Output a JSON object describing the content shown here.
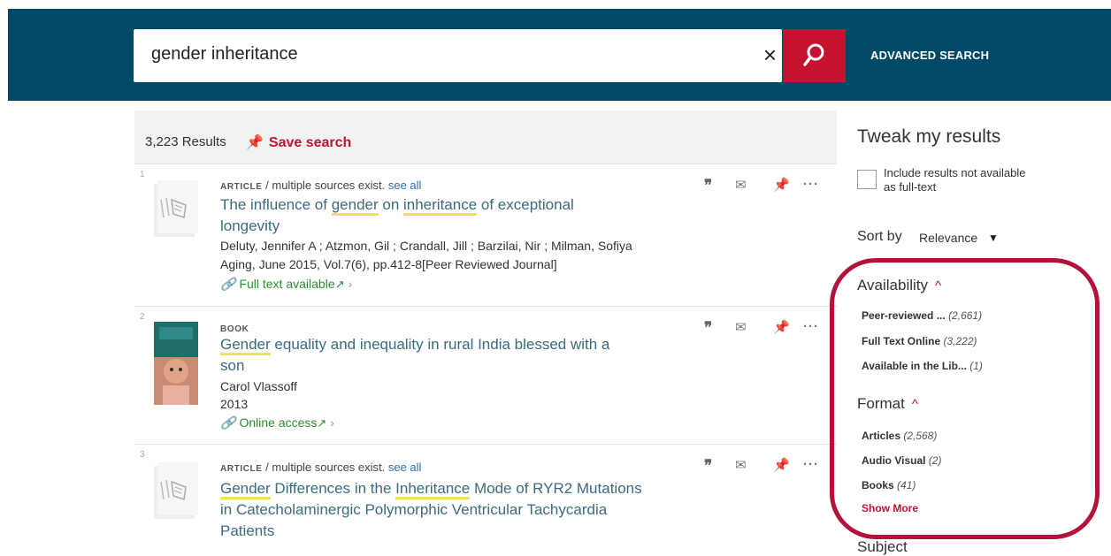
{
  "search": {
    "query": "gender inheritance",
    "clear_symbol": "×",
    "advanced_label": "ADVANCED SEARCH"
  },
  "results_bar": {
    "count": "3,223 Results",
    "save_label": "Save search"
  },
  "results": [
    {
      "num": "1",
      "type": "ARTICLE",
      "source_note": " / multiple sources exist. ",
      "see_all": "see all",
      "title_line1_a": "The influence of ",
      "title_hl1": "gender",
      "title_line1_b": " on ",
      "title_hl2": "inheritance",
      "title_line1_c": " of exceptional",
      "title_line2": "longevity",
      "authors": "Deluty, Jennifer A ; Atzmon, Gil ; Crandall, Jill ; Barzilai, Nir ; Milman, Sofiya",
      "source": "Aging, June 2015, Vol.7(6), pp.412-8[Peer Reviewed Journal]",
      "availability": "Full text available"
    },
    {
      "num": "2",
      "type": "BOOK",
      "title_hl1": "Gender",
      "title_line1_a": " equality and inequality in rural India blessed with a",
      "title_line2": "son",
      "authors": "Carol Vlassoff",
      "year": "2013",
      "availability": "Online access"
    },
    {
      "num": "3",
      "type": "ARTICLE",
      "source_note": " / multiple sources exist. ",
      "see_all": "see all",
      "title_hl1": "Gender",
      "title_line1_a": " Differences in the ",
      "title_hl2": "Inheritance",
      "title_line1_b": " Mode of RYR2 Mutations",
      "title_line2": "in Catecholaminergic Polymorphic Ventricular Tachycardia",
      "title_line3": "Patients"
    }
  ],
  "sidebar": {
    "title": "Tweak my results",
    "include_label": "Include results not available as full-text",
    "sort_label": "Sort by",
    "sort_value": "Relevance",
    "availability": {
      "title": "Availability",
      "items": [
        {
          "label": "Peer-reviewed ...",
          "count": "(2,661)"
        },
        {
          "label": "Full Text Online",
          "count": "(3,222)"
        },
        {
          "label": "Available in the Lib...",
          "count": "(1)"
        }
      ]
    },
    "format": {
      "title": "Format",
      "items": [
        {
          "label": "Articles",
          "count": "(2,568)"
        },
        {
          "label": "Audio Visual",
          "count": "(2)"
        },
        {
          "label": "Books",
          "count": "(41)"
        }
      ],
      "show_more": "Show More"
    },
    "subject_title": "Subject"
  },
  "colors": {
    "header": "#004a68",
    "accent": "#c41230",
    "link": "#3c6b80",
    "available": "#2e8b2e",
    "highlight": "#f5e05a"
  }
}
